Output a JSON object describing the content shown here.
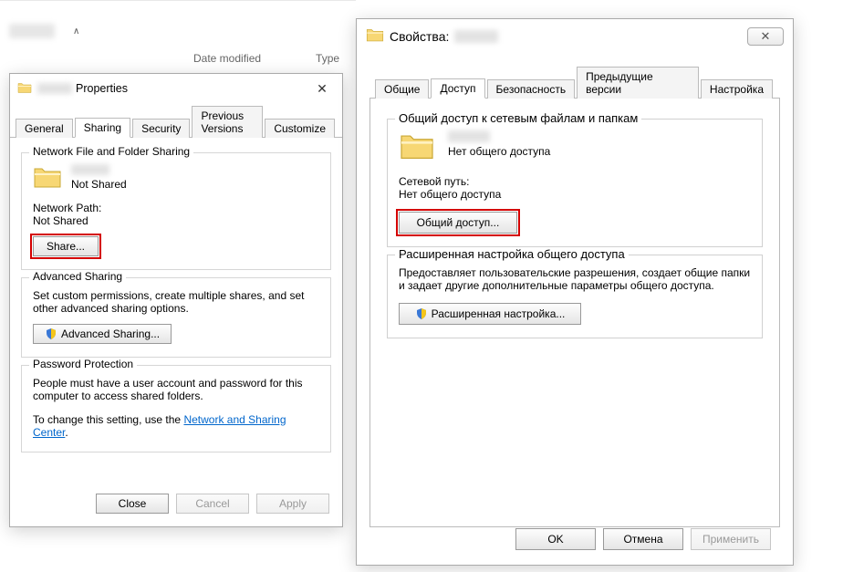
{
  "explorer": {
    "col_date": "Date modified",
    "col_type": "Type",
    "sort_indicator": "∧"
  },
  "dialog_en": {
    "title_suffix": "Properties",
    "tabs": {
      "general": "General",
      "sharing": "Sharing",
      "security": "Security",
      "previous": "Previous Versions",
      "customize": "Customize"
    },
    "nfs": {
      "legend": "Network File and Folder Sharing",
      "status": "Not Shared",
      "path_label": "Network Path:",
      "path_value": "Not Shared",
      "share_btn": "Share..."
    },
    "adv": {
      "legend": "Advanced Sharing",
      "desc": "Set custom permissions, create multiple shares, and set other advanced sharing options.",
      "btn": "Advanced Sharing..."
    },
    "pwd": {
      "legend": "Password Protection",
      "desc1": "People must have a user account and password for this computer to access shared folders.",
      "desc2_prefix": "To change this setting, use the ",
      "desc2_link": "Network and Sharing Center",
      "desc2_suffix": "."
    },
    "buttons": {
      "close": "Close",
      "cancel": "Cancel",
      "apply": "Apply"
    }
  },
  "dialog_ru": {
    "title_prefix": "Свойства:",
    "tabs": {
      "general": "Общие",
      "sharing": "Доступ",
      "security": "Безопасность",
      "previous": "Предыдущие версии",
      "customize": "Настройка"
    },
    "nfs": {
      "legend": "Общий доступ к сетевым файлам и папкам",
      "status": "Нет общего доступа",
      "path_label": "Сетевой путь:",
      "path_value": "Нет общего доступа",
      "share_btn": "Общий доступ..."
    },
    "adv": {
      "legend": "Расширенная настройка общего доступа",
      "desc": "Предоставляет пользовательские разрешения, создает общие папки и задает другие дополнительные параметры общего доступа.",
      "btn": "Расширенная настройка..."
    },
    "buttons": {
      "ok": "OK",
      "cancel": "Отмена",
      "apply": "Применить"
    }
  }
}
